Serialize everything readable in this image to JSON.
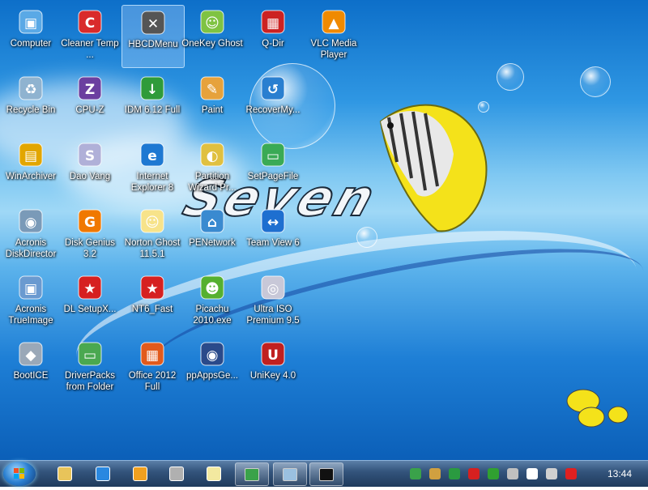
{
  "desktop": {
    "wallpaper_text": "Seven",
    "icons": [
      {
        "label": "Computer",
        "icon": "computer-icon"
      },
      {
        "label": "Cleaner Temp ...",
        "icon": "cleaner-icon"
      },
      {
        "label": "HBCDMenu",
        "icon": "tools-icon",
        "selected": true
      },
      {
        "label": "OneKey Ghost",
        "icon": "ghost-icon"
      },
      {
        "label": "Q-Dir",
        "icon": "qdir-icon"
      },
      {
        "label": "VLC Media Player",
        "icon": "vlc-icon"
      },
      {
        "label": "Recycle Bin",
        "icon": "recycle-bin-icon"
      },
      {
        "label": "CPU-Z",
        "icon": "cpuz-icon"
      },
      {
        "label": "IDM 6.12 Full",
        "icon": "idm-icon"
      },
      {
        "label": "Paint",
        "icon": "paint-icon"
      },
      {
        "label": "RecoverMy...",
        "icon": "recover-icon"
      },
      {
        "label": "WinArchiver",
        "icon": "archiver-icon"
      },
      {
        "label": "Dao Vang",
        "icon": "daovang-icon"
      },
      {
        "label": "Internet Explorer 8",
        "icon": "ie-icon"
      },
      {
        "label": "Partition Wizard Pr...",
        "icon": "partition-icon"
      },
      {
        "label": "SetPageFile",
        "icon": "setpagefile-icon"
      },
      {
        "label": "Acronis DiskDirector",
        "icon": "acronis-disk-icon"
      },
      {
        "label": "Disk Genius 3.2",
        "icon": "diskgenius-icon"
      },
      {
        "label": "Norton Ghost 11.5.1",
        "icon": "norton-ghost-icon"
      },
      {
        "label": "PENetwork",
        "icon": "network-icon"
      },
      {
        "label": "Team View 6",
        "icon": "teamviewer-icon"
      },
      {
        "label": "Acronis TrueImage",
        "icon": "acronis-true-icon"
      },
      {
        "label": "DL SetupX...",
        "icon": "star-icon"
      },
      {
        "label": "NT6_Fast",
        "icon": "star-icon"
      },
      {
        "label": "Picachu 2010.exe",
        "icon": "picachu-icon"
      },
      {
        "label": "Ultra ISO Premium 9.5",
        "icon": "ultraiso-icon"
      },
      {
        "label": "BootICE",
        "icon": "bootice-icon"
      },
      {
        "label": "DriverPacks from Folder",
        "icon": "driverpacks-icon"
      },
      {
        "label": "Office 2012 Full",
        "icon": "office-icon"
      },
      {
        "label": "ppAppsGe...",
        "icon": "ppapps-icon"
      },
      {
        "label": "UniKey 4.0",
        "icon": "unikey-icon"
      }
    ]
  },
  "taskbar": {
    "start": "start-orb-icon",
    "pinned": [
      "explorer-folder-icon",
      "ie-icon",
      "media-player-icon",
      "tools-icon",
      "ghost-icon"
    ],
    "windows": [
      "partition-icon",
      "qdir-icon",
      "cmd-icon"
    ],
    "tray_icons": [
      "network-icon",
      "usb-icon",
      "play-icon",
      "record-icon",
      "check-icon",
      "usb-eject-icon",
      "flag-icon",
      "display-icon",
      "volume-muted-icon"
    ],
    "clock": "13:44"
  },
  "colors": {
    "accent": "#2f97e3",
    "taskbar": "#1e3a5c"
  }
}
